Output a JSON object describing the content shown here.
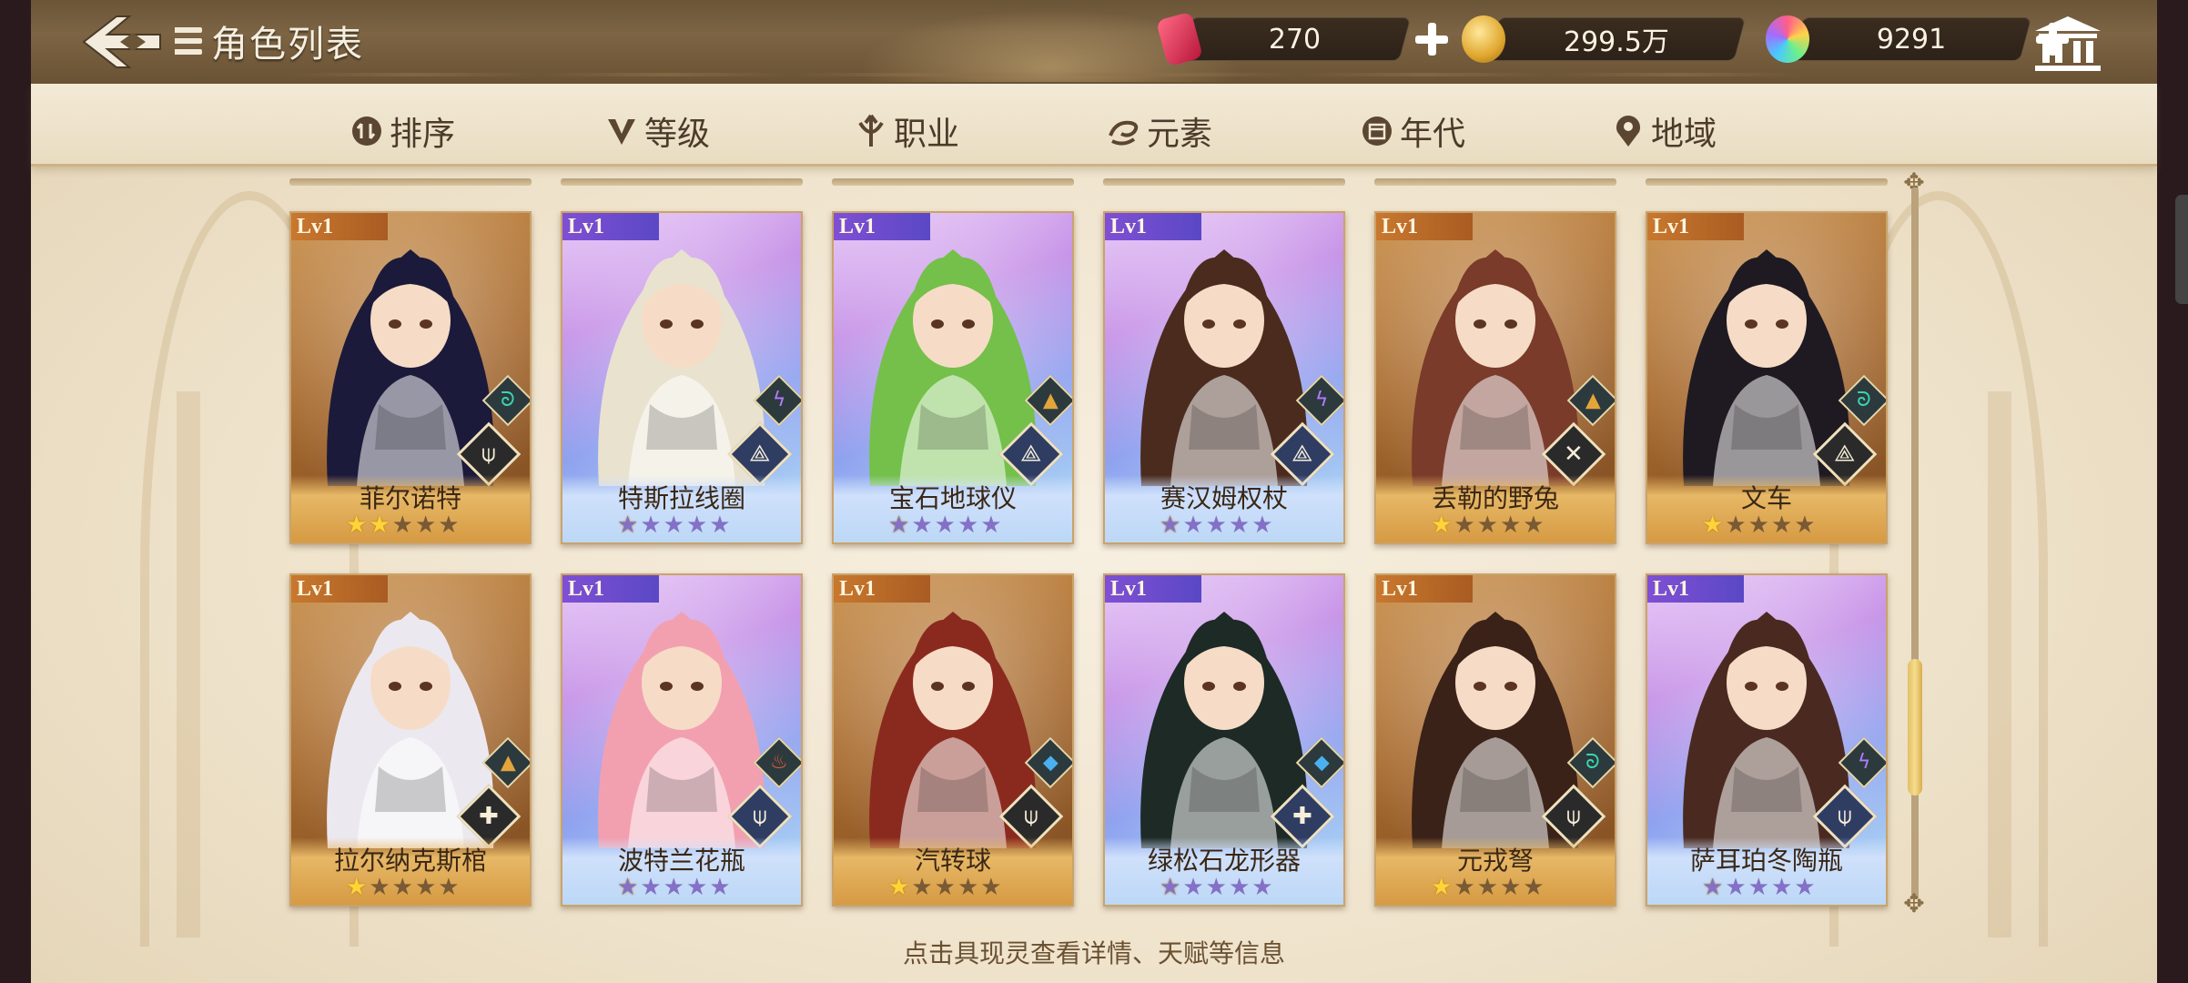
{
  "header": {
    "title": "角色列表",
    "back_icon": "back-arrow-icon",
    "currencies": [
      {
        "name": "energy-drink",
        "value": "270",
        "icon_color": "#d83a55"
      },
      {
        "name": "gold-coin",
        "value": "299.5万",
        "icon_color": "#e9b53b"
      },
      {
        "name": "rainbow-gem",
        "value": "9291",
        "icon_color": "#9b6bd8"
      }
    ],
    "museum_icon": "museum-icon"
  },
  "tabs": [
    {
      "label": "排序",
      "icon": "sort-icon"
    },
    {
      "label": "等级",
      "icon": "level-v-icon"
    },
    {
      "label": "职业",
      "icon": "class-icon"
    },
    {
      "label": "元素",
      "icon": "element-swirl-icon"
    },
    {
      "label": "年代",
      "icon": "calendar-icon"
    },
    {
      "label": "地域",
      "icon": "location-pin-icon"
    }
  ],
  "characters": [
    {
      "name": "菲尔诺特",
      "level": "Lv1",
      "rarity": "orange",
      "stars_on": 2,
      "stars_total": 5,
      "element": "wind",
      "element_symbol": "ᘐ",
      "element_color": "#3ad6b0",
      "class_symbol": "⍦",
      "hair": "#1c1a3a",
      "bg": "#8a5a2c"
    },
    {
      "name": "特斯拉线圈",
      "level": "Lv1",
      "rarity": "purple",
      "stars_on": 1,
      "stars_total": 5,
      "element": "thunder",
      "element_symbol": "ϟ",
      "element_color": "#b27cff",
      "class_symbol": "⟁",
      "hair": "#e9e2cf",
      "bg": "#d7b8ee"
    },
    {
      "name": "宝石地球仪",
      "level": "Lv1",
      "rarity": "purple",
      "stars_on": 1,
      "stars_total": 5,
      "element": "earth",
      "element_symbol": "▲",
      "element_color": "#e3a43a",
      "class_symbol": "⟁",
      "hair": "#74c04a",
      "bg": "#d7b8ee"
    },
    {
      "name": "赛汉姆权杖",
      "level": "Lv1",
      "rarity": "purple",
      "stars_on": 1,
      "stars_total": 5,
      "element": "thunder",
      "element_symbol": "ϟ",
      "element_color": "#b27cff",
      "class_symbol": "⟁",
      "hair": "#4a2b1e",
      "bg": "#c1a6ea"
    },
    {
      "name": "丢勒的野兔",
      "level": "Lv1",
      "rarity": "orange",
      "stars_on": 1,
      "stars_total": 5,
      "element": "earth",
      "element_symbol": "▲",
      "element_color": "#e3a43a",
      "class_symbol": "✕",
      "hair": "#7a3b2a",
      "bg": "#b88a58"
    },
    {
      "name": "文车",
      "level": "Lv1",
      "rarity": "orange",
      "stars_on": 1,
      "stars_total": 5,
      "element": "wind",
      "element_symbol": "ᘐ",
      "element_color": "#3ad6b0",
      "class_symbol": "⟁",
      "hair": "#1f1a22",
      "bg": "#b9b5d3"
    },
    {
      "name": "拉尔纳克斯棺",
      "level": "Lv1",
      "rarity": "orange",
      "stars_on": 1,
      "stars_total": 5,
      "element": "earth",
      "element_symbol": "▲",
      "element_color": "#e3a43a",
      "class_symbol": "✚",
      "hair": "#ece8f0",
      "bg": "#c99658"
    },
    {
      "name": "波特兰花瓶",
      "level": "Lv1",
      "rarity": "purple",
      "stars_on": 1,
      "stars_total": 5,
      "element": "fire",
      "element_symbol": "♨",
      "element_color": "#ef5a3a",
      "class_symbol": "⍦",
      "hair": "#f2a0b0",
      "bg": "#d7b8ee"
    },
    {
      "name": "汽转球",
      "level": "Lv1",
      "rarity": "orange",
      "stars_on": 1,
      "stars_total": 5,
      "element": "water",
      "element_symbol": "◆",
      "element_color": "#4ab0f0",
      "class_symbol": "⍦",
      "hair": "#8a2a1e",
      "bg": "#6a4a30"
    },
    {
      "name": "绿松石龙形器",
      "level": "Lv1",
      "rarity": "purple",
      "stars_on": 1,
      "stars_total": 5,
      "element": "water",
      "element_symbol": "◆",
      "element_color": "#4ab0f0",
      "class_symbol": "✚",
      "hair": "#1d2a26",
      "bg": "#b7d4e8"
    },
    {
      "name": "元戎弩",
      "level": "Lv1",
      "rarity": "orange",
      "stars_on": 1,
      "stars_total": 5,
      "element": "wind",
      "element_symbol": "ᘐ",
      "element_color": "#3ad6b0",
      "class_symbol": "⍦",
      "hair": "#3b2218",
      "bg": "#7c5232"
    },
    {
      "name": "萨耳珀冬陶瓶",
      "level": "Lv1",
      "rarity": "purple",
      "stars_on": 1,
      "stars_total": 5,
      "element": "thunder",
      "element_symbol": "ϟ",
      "element_color": "#b27cff",
      "class_symbol": "⍦",
      "hair": "#4a2a20",
      "bg": "#c7b0ec"
    }
  ],
  "scroll_position": 0.82,
  "hint": "点击具现灵查看详情、天赋等信息"
}
